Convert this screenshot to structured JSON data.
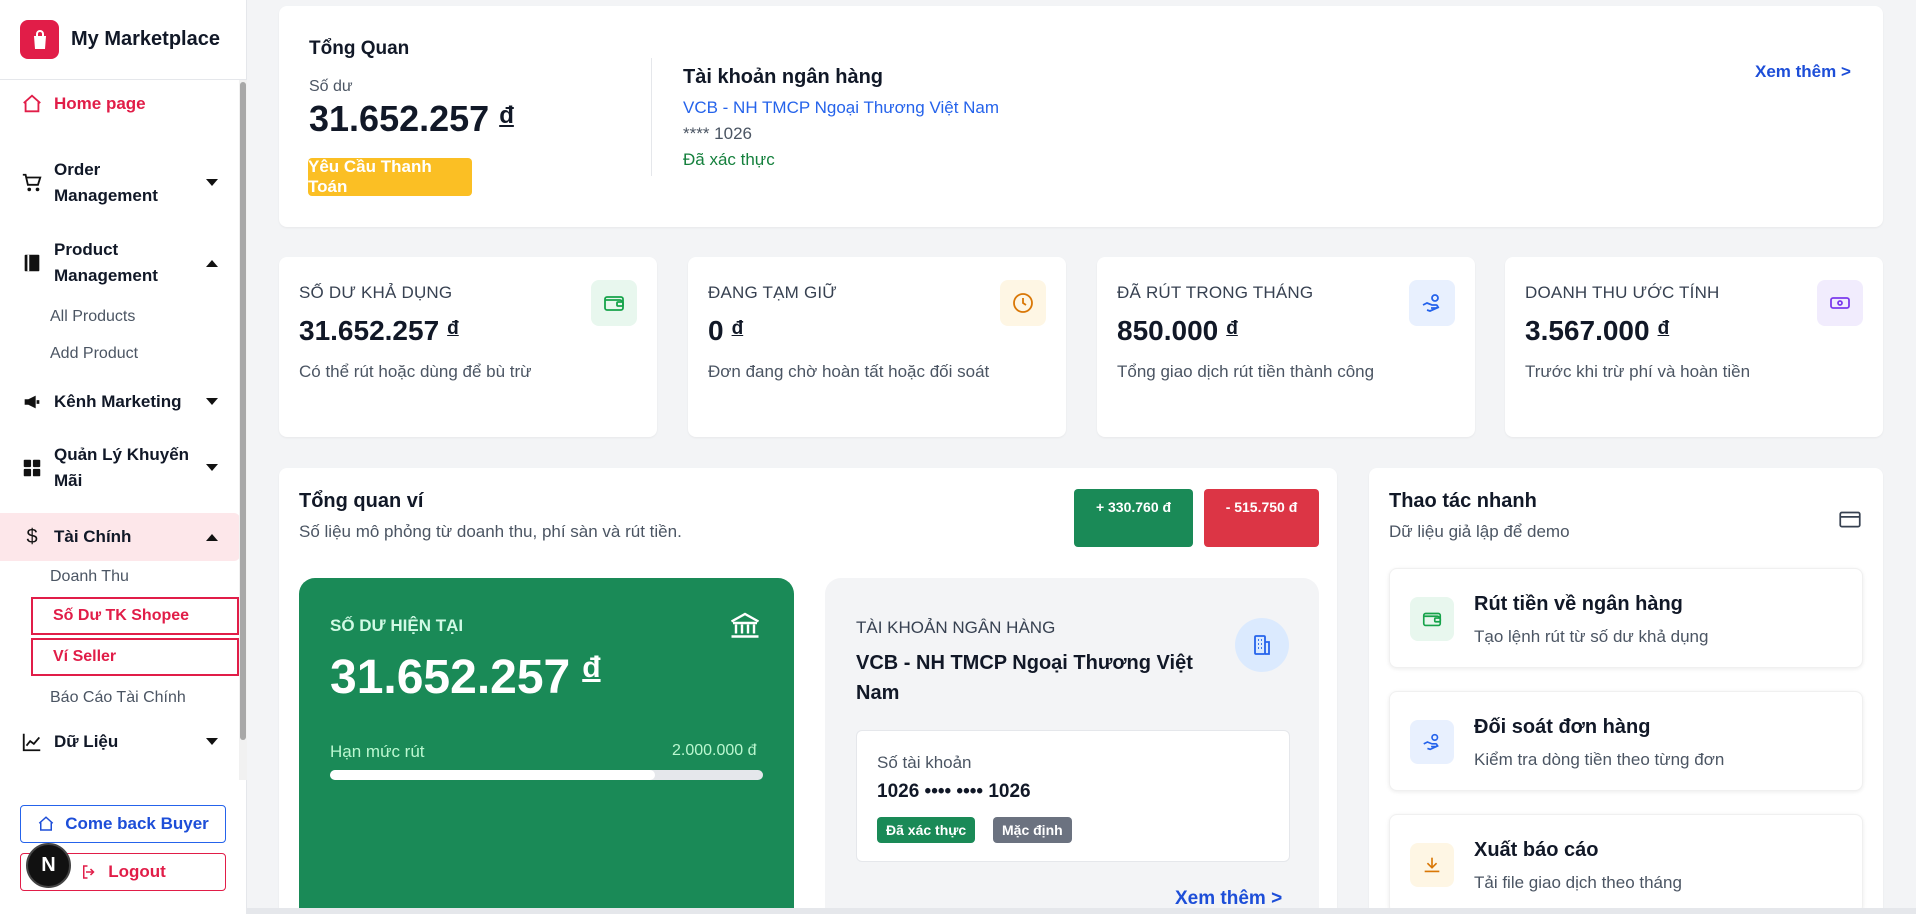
{
  "brand": {
    "name": "My Marketplace"
  },
  "sidebar": {
    "home": "Home page",
    "order": "Order Management",
    "product": "Product Management",
    "product_subs": [
      "All Products",
      "Add Product"
    ],
    "marketing": "Kênh Marketing",
    "promo": "Quản Lý Khuyến Mãi",
    "finance": "Tài Chính",
    "finance_subs": [
      "Doanh Thu",
      "Số Dư TK Shopee",
      "Ví Seller",
      "Báo Cáo Tài Chính"
    ],
    "data": "Dữ Liệu",
    "buyer_btn": "Come back Buyer",
    "logout_btn": "Logout",
    "fab": "N"
  },
  "overview": {
    "title": "Tổng Quan",
    "balance_label": "Số dư",
    "balance": "31.652.257",
    "currency": "đ",
    "pay_button": "Yêu Cầu Thanh Toán",
    "bank_title": "Tài khoản ngân hàng",
    "bank_name": "VCB - NH TMCP Ngoại Thương Việt Nam",
    "bank_account": "**** 1026",
    "bank_status": "Đã xác thực",
    "more": "Xem thêm >"
  },
  "stats": [
    {
      "title": "SỐ DƯ KHẢ DỤNG",
      "value": "31.652.257",
      "desc": "Có thể rút hoặc dùng để bù trừ",
      "icon": "wallet-icon",
      "color": "#16a34a",
      "bg": "#e8f7ee"
    },
    {
      "title": "ĐANG TẠM GIỮ",
      "value": "0",
      "desc": "Đơn đang chờ hoàn tất hoặc đối soát",
      "icon": "clock-icon",
      "color": "#d97706",
      "bg": "#fef6e4"
    },
    {
      "title": "ĐÃ RÚT TRONG THÁNG",
      "value": "850.000",
      "desc": "Tổng giao dịch rút tiền thành công",
      "icon": "hand-money-icon",
      "color": "#2563eb",
      "bg": "#e8f0fe"
    },
    {
      "title": "DOANH THU ƯỚC TÍNH",
      "value": "3.567.000",
      "desc": "Trước khi trừ phí và hoàn tiền",
      "icon": "cash-icon",
      "color": "#7c3aed",
      "bg": "#f1ecfd"
    }
  ],
  "wallet": {
    "title": "Tổng quan ví",
    "subtitle": "Số liệu mô phỏng từ doanh thu, phí sàn và rút tiền.",
    "income_pill": "+ 330.760 đ",
    "expense_pill": "- 515.750 đ",
    "current_label": "SỐ DƯ HIỆN TẠI",
    "current_value": "31.652.257",
    "limit_label": "Hạn mức rút",
    "limit_value": "2.000.000 đ",
    "limit_used_pct": 75,
    "bank_label": "TÀI KHOẢN NGÂN HÀNG",
    "bank_name": "VCB - NH TMCP Ngoại Thương Việt Nam",
    "acc_label": "Số tài khoản",
    "acc_value": "1026 •••• •••• 1026",
    "tag_verified": "Đã xác thực",
    "tag_default": "Mặc định",
    "more": "Xem thêm >"
  },
  "quick": {
    "title": "Thao tác nhanh",
    "subtitle": "Dữ liệu giả lập để demo",
    "items": [
      {
        "title": "Rút tiền về ngân hàng",
        "desc": "Tạo lệnh rút từ số dư khả dụng",
        "icon": "wallet-icon",
        "color": "#16a34a",
        "bg": "#e8f7ee"
      },
      {
        "title": "Đối soát đơn hàng",
        "desc": "Kiểm tra dòng tiền theo từng đơn",
        "icon": "hand-money-icon",
        "color": "#2563eb",
        "bg": "#e8f0fe"
      },
      {
        "title": "Xuất báo cáo",
        "desc": "Tải file giao dịch theo tháng",
        "icon": "download-icon",
        "color": "#d97706",
        "bg": "#fef6e4"
      }
    ]
  }
}
